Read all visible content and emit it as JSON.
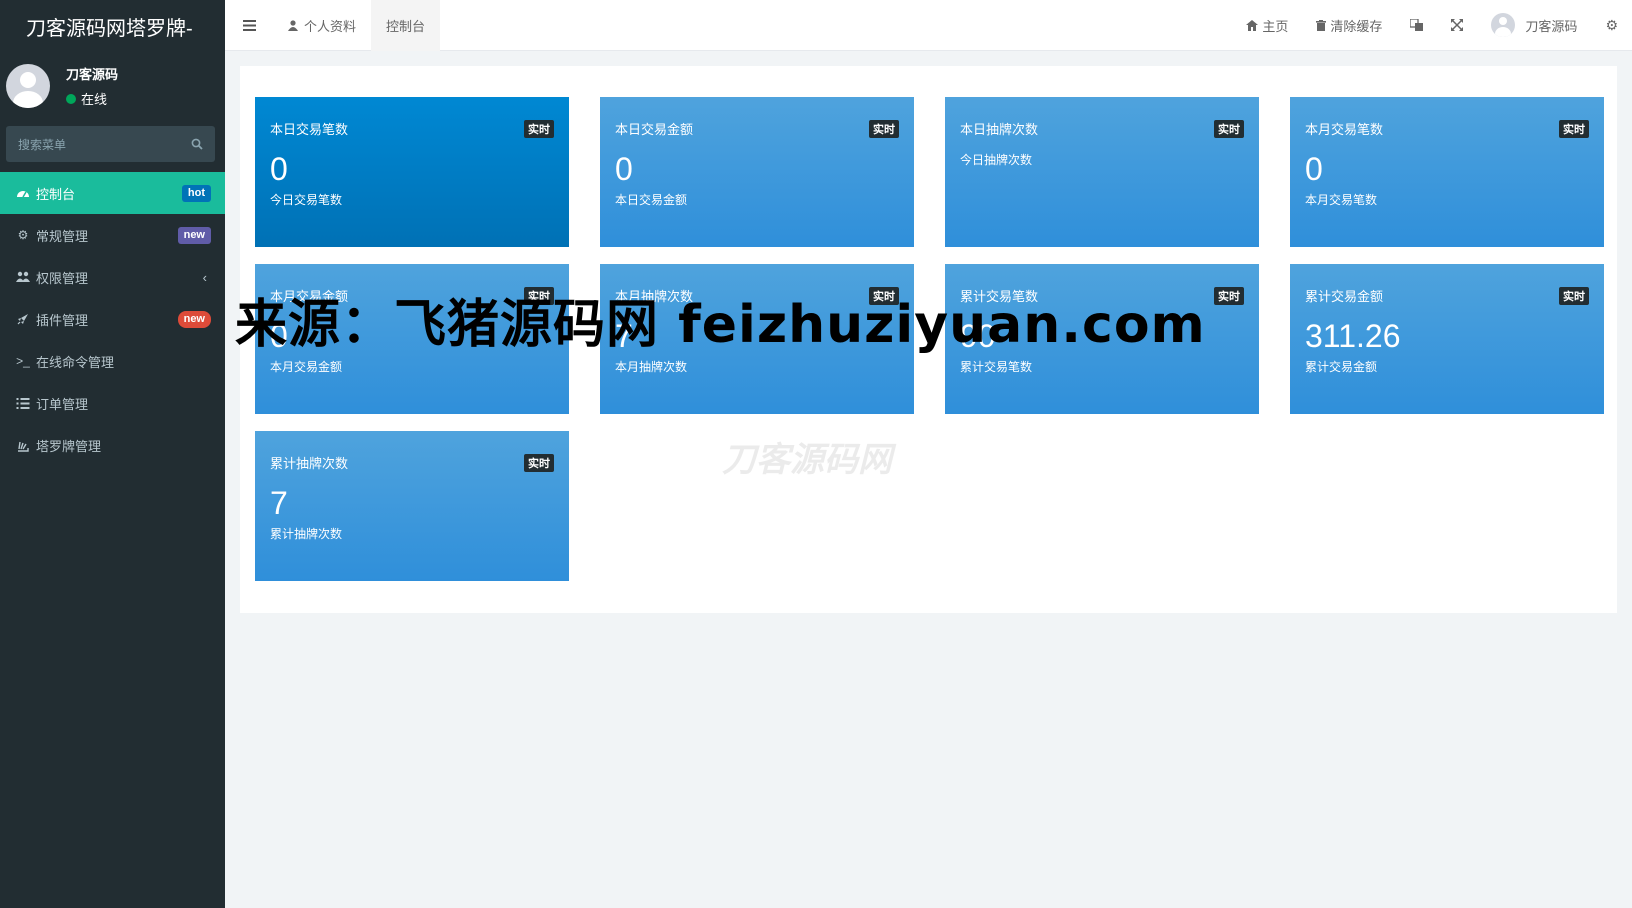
{
  "sidebar": {
    "logo": "刀客源码网塔罗牌-",
    "user": {
      "name": "刀客源码",
      "status": "在线"
    },
    "search_placeholder": "搜索菜单",
    "items": [
      {
        "icon": "dashboard-icon",
        "label": "控制台",
        "badge": "hot"
      },
      {
        "icon": "cogs-icon",
        "label": "常规管理",
        "badge": "new"
      },
      {
        "icon": "users-icon",
        "label": "权限管理"
      },
      {
        "icon": "rocket-icon",
        "label": "插件管理",
        "badge": "new"
      },
      {
        "icon": "terminal-icon",
        "label": "在线命令管理"
      },
      {
        "icon": "list-icon",
        "label": "订单管理"
      },
      {
        "icon": "stack-icon",
        "label": "塔罗牌管理"
      }
    ]
  },
  "navbar": {
    "profile_tab": "个人资料",
    "dashboard_tab": "控制台",
    "home": "主页",
    "clear_cache": "清除缓存",
    "username": "刀客源码"
  },
  "cards": [
    {
      "title": "本日交易笔数",
      "tag": "实时",
      "value": "0",
      "sub": "今日交易笔数"
    },
    {
      "title": "本日交易金额",
      "tag": "实时",
      "value": "0",
      "sub": "本日交易金额"
    },
    {
      "title": "本日抽牌次数",
      "tag": "实时",
      "value": "",
      "sub": "今日抽牌次数"
    },
    {
      "title": "本月交易笔数",
      "tag": "实时",
      "value": "0",
      "sub": "本月交易笔数"
    },
    {
      "title": "本月交易金额",
      "tag": "实时",
      "value": "0",
      "sub": "本月交易金额"
    },
    {
      "title": "本月抽牌次数",
      "tag": "实时",
      "value": "7",
      "sub": "本月抽牌次数"
    },
    {
      "title": "累计交易笔数",
      "tag": "实时",
      "value": "90",
      "sub": "累计交易笔数"
    },
    {
      "title": "累计交易金额",
      "tag": "实时",
      "value": "311.26",
      "sub": "累计交易金额"
    },
    {
      "title": "累计抽牌次数",
      "tag": "实时",
      "value": "7",
      "sub": "累计抽牌次数"
    }
  ],
  "watermarks": {
    "main": "来源：飞猪源码网 feizhuziyuan.com",
    "faint": "刀客源码网"
  }
}
